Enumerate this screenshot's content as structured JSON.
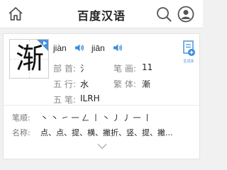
{
  "header": {
    "title": "百度汉语"
  },
  "entry": {
    "character": "渐",
    "pronunciations": [
      {
        "pinyin": "jiàn"
      },
      {
        "pinyin": "jiān"
      }
    ],
    "wordbook_label": "生词本",
    "fields": {
      "radical_label": "部 首:",
      "radical_value": "氵",
      "strokes_label": "笔 画:",
      "strokes_value": "11",
      "wuxing_label": "五 行:",
      "wuxing_value": "水",
      "traditional_label": "繁 体:",
      "traditional_value": "漸",
      "wubi_label": "五 笔:",
      "wubi_value": "ILRH"
    },
    "stroke_order_label": "笔顺:",
    "stroke_order_value": "丶 丶 ㇀ 一 ㄥ 丨 丶 丿 丿 一 丨",
    "stroke_names_label": "名称:",
    "stroke_names_value": "点、点、提、横、撇折、竖、提、撇..."
  },
  "colors": {
    "accent": "#3b8ed9",
    "label": "#888888",
    "text": "#222222"
  }
}
